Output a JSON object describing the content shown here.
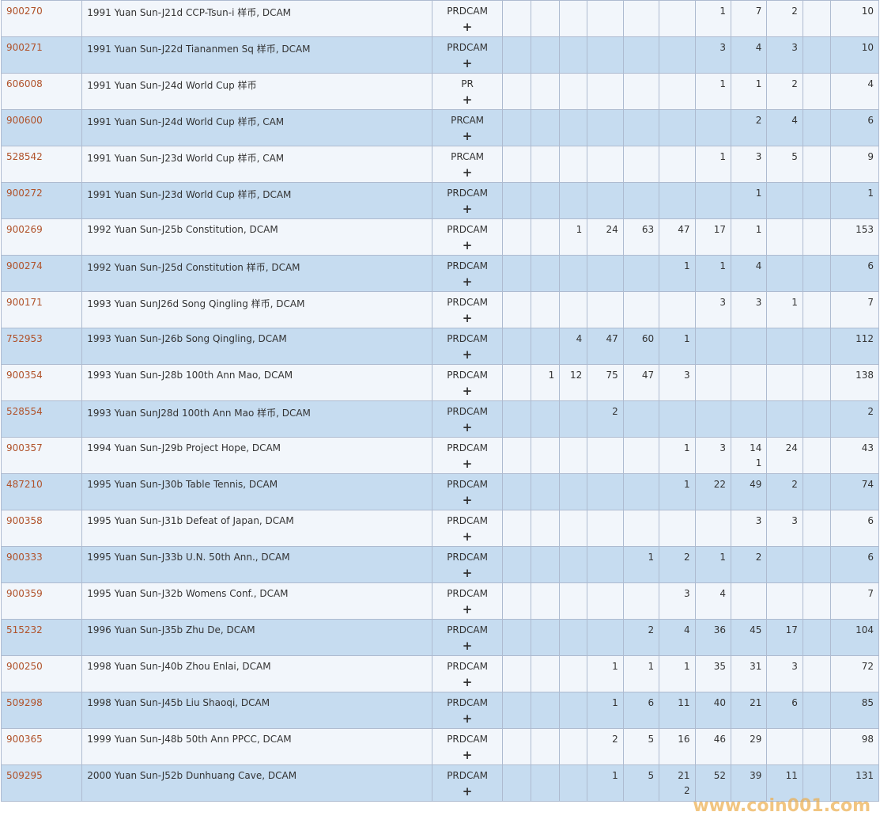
{
  "rows": [
    {
      "code": "900270",
      "desc": "1991 Yuan Sun-J21d CCP-Tsun-i 样币, DCAM",
      "type": "PRDCAM",
      "counts": [
        "",
        "",
        "",
        "",
        "",
        "",
        "1",
        "7",
        "2",
        "",
        "10"
      ]
    },
    {
      "code": "900271",
      "desc": "1991 Yuan Sun-J22d Tiananmen Sq 样币, DCAM",
      "type": "PRDCAM",
      "counts": [
        "",
        "",
        "",
        "",
        "",
        "",
        "3",
        "4",
        "3",
        "",
        "10"
      ]
    },
    {
      "code": "606008",
      "desc": "1991 Yuan Sun-J24d World Cup 样币",
      "type": "PR",
      "counts": [
        "",
        "",
        "",
        "",
        "",
        "",
        "1",
        "1",
        "2",
        "",
        "4"
      ]
    },
    {
      "code": "900600",
      "desc": "1991 Yuan Sun-J24d World Cup 样币, CAM",
      "type": "PRCAM",
      "counts": [
        "",
        "",
        "",
        "",
        "",
        "",
        "",
        "2",
        "4",
        "",
        "6"
      ]
    },
    {
      "code": "528542",
      "desc": "1991 Yuan Sun-J23d World Cup 样币, CAM",
      "type": "PRCAM",
      "counts": [
        "",
        "",
        "",
        "",
        "",
        "",
        "1",
        "3",
        "5",
        "",
        "9"
      ]
    },
    {
      "code": "900272",
      "desc": "1991 Yuan Sun-J23d World Cup 样币, DCAM",
      "type": "PRDCAM",
      "counts": [
        "",
        "",
        "",
        "",
        "",
        "",
        "",
        "1",
        "",
        "",
        "1"
      ]
    },
    {
      "code": "900269",
      "desc": "1992 Yuan Sun-J25b Constitution, DCAM",
      "type": "PRDCAM",
      "counts": [
        "",
        "",
        "1",
        "24",
        "63",
        "47",
        "17",
        "1",
        "",
        "",
        "153"
      ]
    },
    {
      "code": "900274",
      "desc": "1992 Yuan Sun-J25d Constitution 样币, DCAM",
      "type": "PRDCAM",
      "counts": [
        "",
        "",
        "",
        "",
        "",
        "1",
        "1",
        "4",
        "",
        "",
        "6"
      ]
    },
    {
      "code": "900171",
      "desc": "1993 Yuan SunJ26d Song Qingling 样币, DCAM",
      "type": "PRDCAM",
      "counts": [
        "",
        "",
        "",
        "",
        "",
        "",
        "3",
        "3",
        "1",
        "",
        "7"
      ]
    },
    {
      "code": "752953",
      "desc": "1993 Yuan Sun-J26b Song Qingling, DCAM",
      "type": "PRDCAM",
      "counts": [
        "",
        "",
        "4",
        "47",
        "60",
        "1",
        "",
        "",
        "",
        "",
        "112"
      ]
    },
    {
      "code": "900354",
      "desc": "1993 Yuan Sun-J28b 100th Ann Mao, DCAM",
      "type": "PRDCAM",
      "counts": [
        "",
        "1",
        "12",
        "75",
        "47",
        "3",
        "",
        "",
        "",
        "",
        "138"
      ]
    },
    {
      "code": "528554",
      "desc": "1993 Yuan SunJ28d 100th Ann Mao 样币, DCAM",
      "type": "PRDCAM",
      "counts": [
        "",
        "",
        "",
        "2",
        "",
        "",
        "",
        "",
        "",
        "",
        "2"
      ]
    },
    {
      "code": "900357",
      "desc": "1994 Yuan Sun-J29b Project Hope, DCAM",
      "type": "PRDCAM",
      "counts": [
        "",
        "",
        "",
        "",
        "",
        "1",
        "3",
        "14",
        "24",
        "",
        "43"
      ],
      "sub": [
        "",
        "",
        "",
        "",
        "",
        "",
        "",
        "1",
        "",
        "",
        ""
      ]
    },
    {
      "code": "487210",
      "desc": "1995 Yuan Sun-J30b Table Tennis, DCAM",
      "type": "PRDCAM",
      "counts": [
        "",
        "",
        "",
        "",
        "",
        "1",
        "22",
        "49",
        "2",
        "",
        "74"
      ]
    },
    {
      "code": "900358",
      "desc": "1995 Yuan Sun-J31b Defeat of Japan, DCAM",
      "type": "PRDCAM",
      "counts": [
        "",
        "",
        "",
        "",
        "",
        "",
        "",
        "3",
        "3",
        "",
        "6"
      ]
    },
    {
      "code": "900333",
      "desc": "1995 Yuan Sun-J33b U.N. 50th Ann., DCAM",
      "type": "PRDCAM",
      "counts": [
        "",
        "",
        "",
        "",
        "1",
        "2",
        "1",
        "2",
        "",
        "",
        "6"
      ]
    },
    {
      "code": "900359",
      "desc": "1995 Yuan Sun-J32b Womens Conf., DCAM",
      "type": "PRDCAM",
      "counts": [
        "",
        "",
        "",
        "",
        "",
        "3",
        "4",
        "",
        "",
        "",
        "7"
      ]
    },
    {
      "code": "515232",
      "desc": "1996 Yuan Sun-J35b Zhu De, DCAM",
      "type": "PRDCAM",
      "counts": [
        "",
        "",
        "",
        "",
        "2",
        "4",
        "36",
        "45",
        "17",
        "",
        "104"
      ]
    },
    {
      "code": "900250",
      "desc": "1998 Yuan Sun-J40b Zhou Enlai, DCAM",
      "type": "PRDCAM",
      "counts": [
        "",
        "",
        "",
        "1",
        "1",
        "1",
        "35",
        "31",
        "3",
        "",
        "72"
      ]
    },
    {
      "code": "509298",
      "desc": "1998 Yuan Sun-J45b Liu Shaoqi, DCAM",
      "type": "PRDCAM",
      "counts": [
        "",
        "",
        "",
        "1",
        "6",
        "11",
        "40",
        "21",
        "6",
        "",
        "85"
      ]
    },
    {
      "code": "900365",
      "desc": "1999 Yuan Sun-J48b 50th Ann PPCC, DCAM",
      "type": "PRDCAM",
      "counts": [
        "",
        "",
        "",
        "2",
        "5",
        "16",
        "46",
        "29",
        "",
        "",
        "98"
      ]
    },
    {
      "code": "509295",
      "desc": "2000 Yuan Sun-J52b Dunhuang Cave, DCAM",
      "type": "PRDCAM",
      "counts": [
        "",
        "",
        "",
        "1",
        "5",
        "21",
        "52",
        "39",
        "11",
        "",
        "131"
      ],
      "sub": [
        "",
        "",
        "",
        "",
        "",
        "2",
        "",
        "",
        "",
        "",
        ""
      ]
    }
  ],
  "plus_symbol": "+",
  "watermark": "www.coin001.com"
}
